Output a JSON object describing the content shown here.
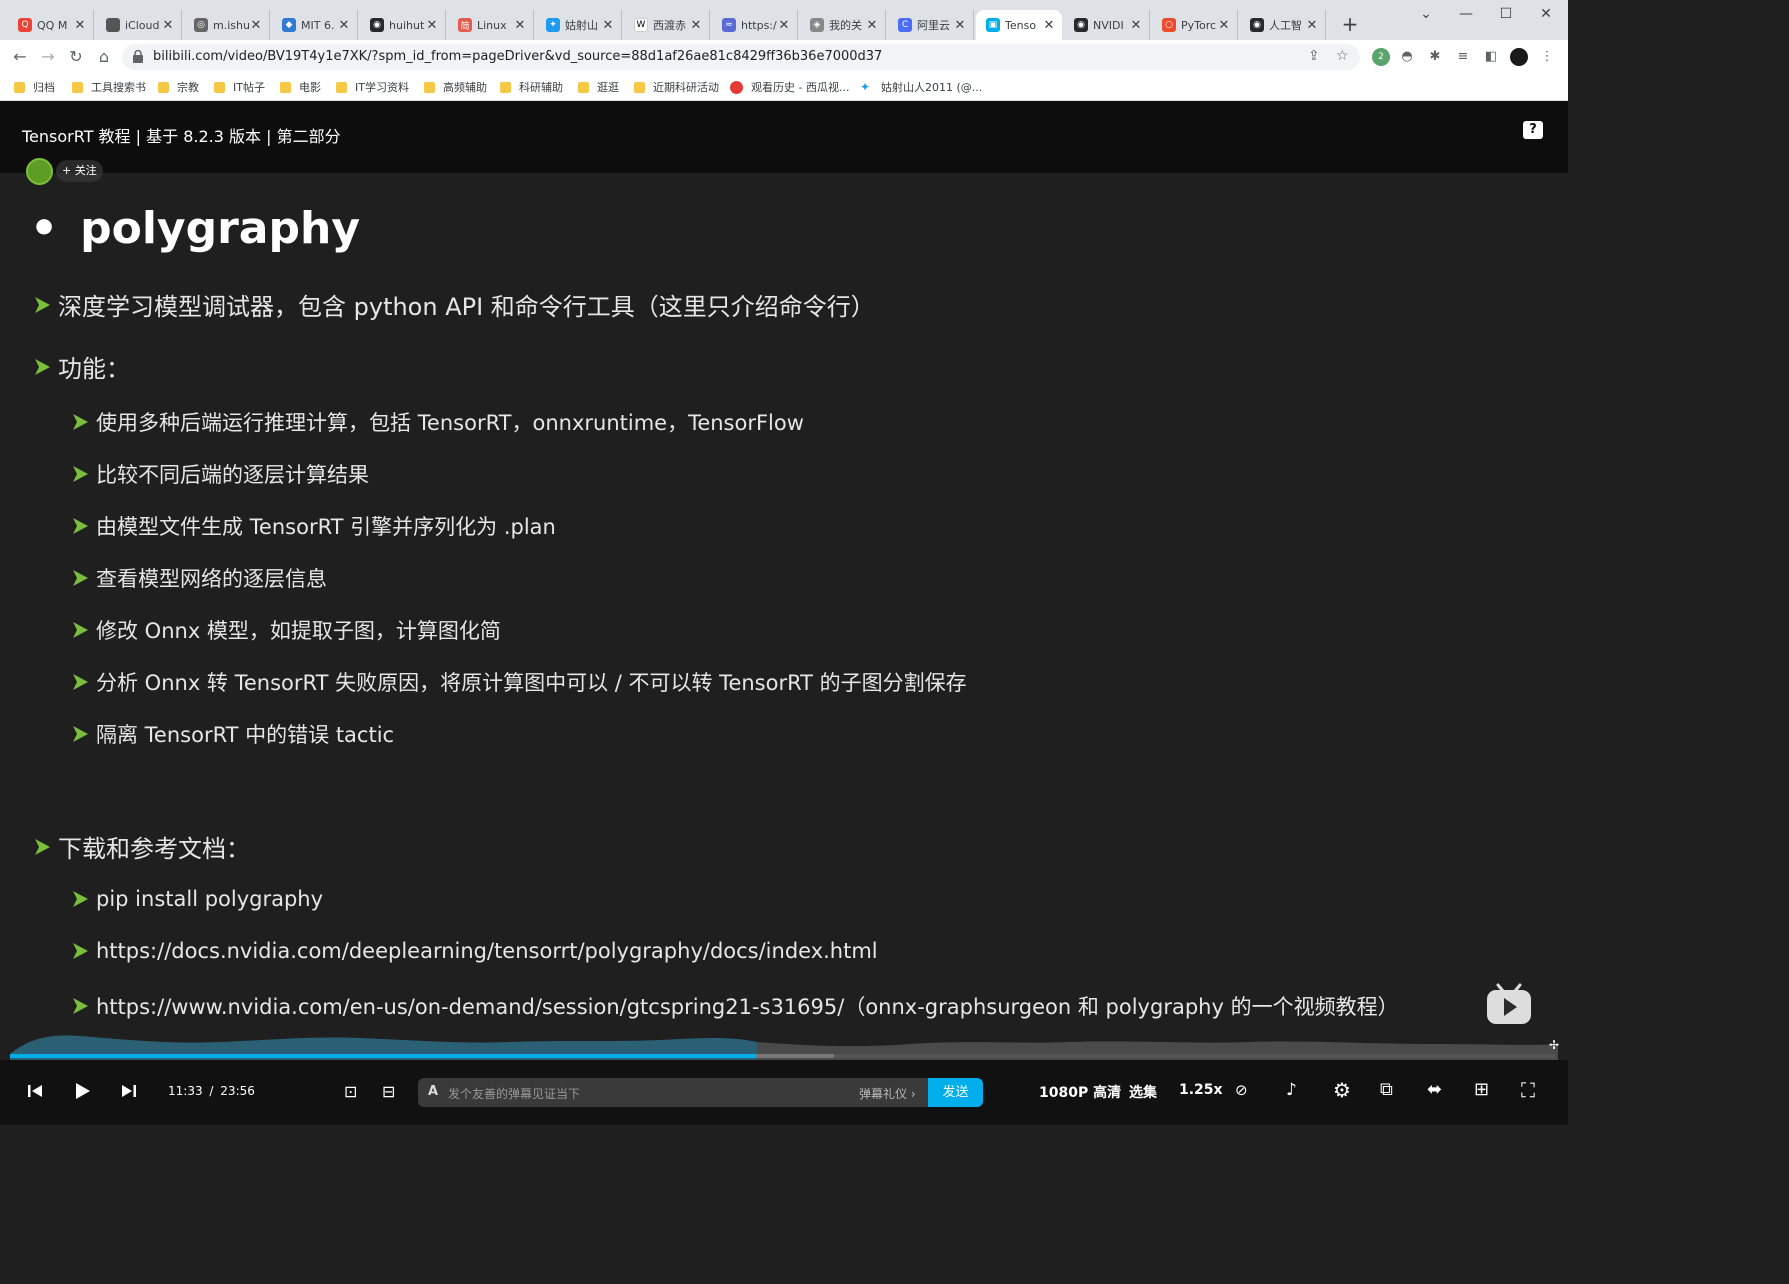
{
  "browser": {
    "tabs": [
      {
        "label": "QQ M",
        "fav_color": "#ea4335",
        "fav_glyph": "Q"
      },
      {
        "label": "iCloud",
        "fav_color": "#555555",
        "fav_glyph": ""
      },
      {
        "label": "m.ishu",
        "fav_color": "#666666",
        "fav_glyph": "◎"
      },
      {
        "label": "MIT 6.",
        "fav_color": "#2f7bd3",
        "fav_glyph": "◆"
      },
      {
        "label": "huihut",
        "fav_color": "#24292f",
        "fav_glyph": "◉"
      },
      {
        "label": "Linux",
        "fav_color": "#e55b4d",
        "fav_glyph": "简"
      },
      {
        "label": "姑射山",
        "fav_color": "#1d9bf0",
        "fav_glyph": "✦"
      },
      {
        "label": "西渡赤",
        "fav_color": "#ffffff",
        "fav_glyph": "W"
      },
      {
        "label": "https:/",
        "fav_color": "#5b6bd6",
        "fav_glyph": "≈"
      },
      {
        "label": "我的关",
        "fav_color": "#888888",
        "fav_glyph": "◈"
      },
      {
        "label": "阿里云",
        "fav_color": "#4a6cf7",
        "fav_glyph": "C"
      },
      {
        "label": "Tenso",
        "fav_color": "#00aeec",
        "fav_glyph": "▣"
      },
      {
        "label": "NVIDI",
        "fav_color": "#24292f",
        "fav_glyph": "◉"
      },
      {
        "label": "PyTorc",
        "fav_color": "#ee4c2c",
        "fav_glyph": "○"
      },
      {
        "label": "人工智",
        "fav_color": "#24292f",
        "fav_glyph": "◉"
      }
    ],
    "active_tab_index": 11,
    "url": "bilibili.com/video/BV19T4y1e7XK/?spm_id_from=pageDriver&vd_source=88d1af26ae81c8429ff36b36e7000d37",
    "bookmarks": [
      {
        "label": "归档",
        "type": "folder"
      },
      {
        "label": "工具搜索书",
        "type": "folder"
      },
      {
        "label": "宗教",
        "type": "folder"
      },
      {
        "label": "IT帖子",
        "type": "folder"
      },
      {
        "label": "电影",
        "type": "folder"
      },
      {
        "label": "IT学习资料",
        "type": "folder"
      },
      {
        "label": "高频辅助",
        "type": "folder"
      },
      {
        "label": "科研辅助",
        "type": "folder"
      },
      {
        "label": "逛逛",
        "type": "folder"
      },
      {
        "label": "近期科研活动",
        "type": "folder"
      },
      {
        "label": "观看历史 - 西瓜视...",
        "type": "red"
      },
      {
        "label": "姑射山人2011 (@...",
        "type": "twitter"
      }
    ],
    "extension_badge": "2"
  },
  "video": {
    "title": "TensorRT 教程 | 基于 8.2.3 版本 | 第二部分",
    "follow_label": "+ 关注",
    "help_glyph": "?"
  },
  "slide": {
    "title": "polygraphy",
    "bullet": "•",
    "accent_color": "#7abf3a",
    "lines": [
      {
        "level": 1,
        "text": "深度学习模型调试器，包含 python API 和命令行工具（这里只介绍命令行）"
      },
      {
        "level": 1,
        "text": "功能："
      },
      {
        "level": 2,
        "text": "使用多种后端运行推理计算，包括 TensorRT，onnxruntime，TensorFlow"
      },
      {
        "level": 2,
        "text": "比较不同后端的逐层计算结果"
      },
      {
        "level": 2,
        "text": "由模型文件生成 TensorRT 引擎并序列化为 .plan"
      },
      {
        "level": 2,
        "text": "查看模型网络的逐层信息"
      },
      {
        "level": 2,
        "text": "修改 Onnx 模型，如提取子图，计算图化简"
      },
      {
        "level": 2,
        "text": "分析 Onnx 转 TensorRT 失败原因，将原计算图中可以 / 不可以转 TensorRT 的子图分割保存"
      },
      {
        "level": 2,
        "text": "隔离 TensorRT 中的错误 tactic"
      },
      {
        "level": 1,
        "text": "下载和参考文档："
      },
      {
        "level": 2,
        "text": "pip install polygraphy"
      },
      {
        "level": 2,
        "text": "https://docs.nvidia.com/deeplearning/tensorrt/polygraphy/docs/index.html"
      },
      {
        "level": 2,
        "text": "https://www.nvidia.com/en-us/on-demand/session/gtcspring21-s31695/（onnx-graphsurgeon 和 polygraphy 的一个视频教程）"
      }
    ]
  },
  "player": {
    "current_time": "11:33",
    "separator": "/",
    "duration": "23:56",
    "played_fraction": 0.483,
    "danmaku_placeholder": "发个友善的弹幕见证当下",
    "danmaku_etiquette": "弹幕礼仪 ›",
    "send_label": "发送",
    "quality": "1080P 高清",
    "episodes": "选集",
    "speed": "1.25x",
    "accent_color": "#00aeec"
  }
}
